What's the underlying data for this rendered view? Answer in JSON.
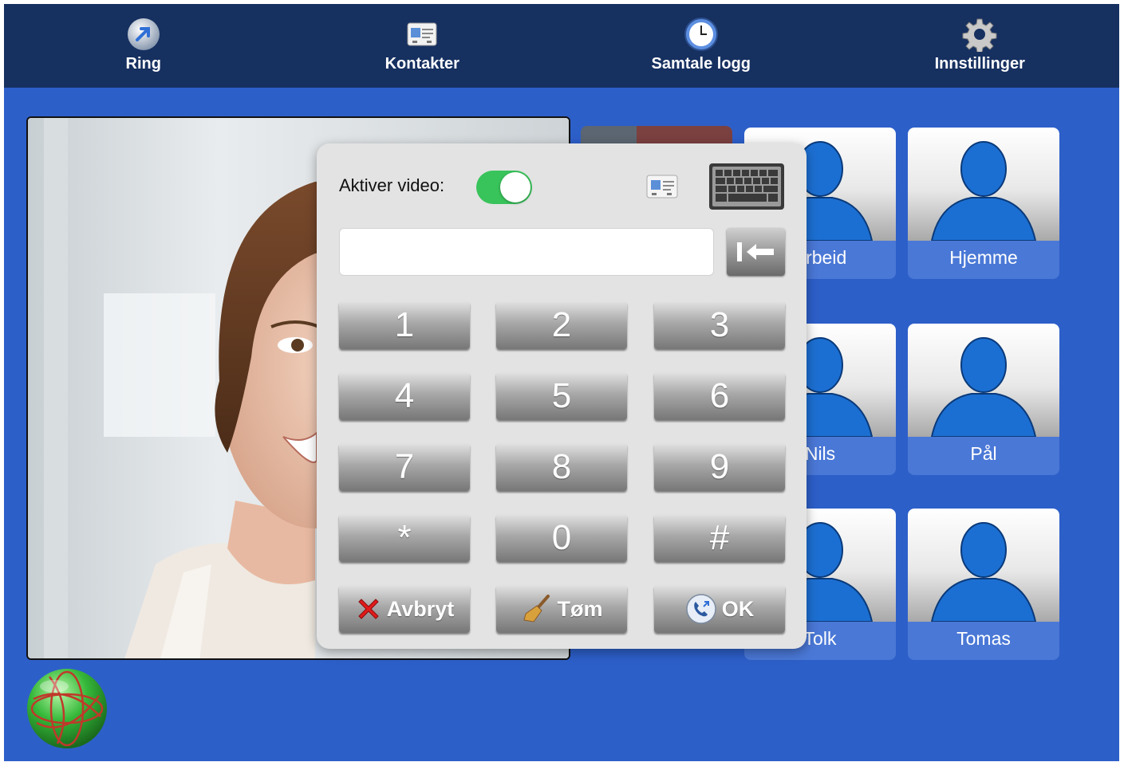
{
  "nav": {
    "ring": "Ring",
    "contacts": "Kontakter",
    "call_log": "Samtale logg",
    "settings": "Innstillinger"
  },
  "contacts": {
    "row1_a": "Arbeid",
    "row1_b": "Hjemme",
    "row2_a": "Nils",
    "row2_b": "Pål",
    "row3_a": "Tolk",
    "row3_b": "Tomas"
  },
  "dialpad": {
    "video_label": "Aktiver video:",
    "video_enabled": true,
    "number_value": "",
    "keys": [
      "1",
      "2",
      "3",
      "4",
      "5",
      "6",
      "7",
      "8",
      "9",
      "*",
      "0",
      "#"
    ],
    "cancel_label": "Avbryt",
    "clear_label": "Tøm",
    "ok_label": "OK"
  },
  "colors": {
    "nav_bg": "#163060",
    "app_bg": "#2d5fc9",
    "toggle_on": "#39c35b",
    "tile_bg": "#4a78d6"
  },
  "icons": {
    "ring": "call-arrow-icon",
    "contacts": "contact-card-icon",
    "call_log": "clock-icon",
    "settings": "gear-icon",
    "backspace": "backspace-icon",
    "keyboard": "keyboard-icon",
    "cancel": "red-x-icon",
    "clear": "broom-icon",
    "ok": "phone-icon",
    "network": "globe-icon"
  }
}
